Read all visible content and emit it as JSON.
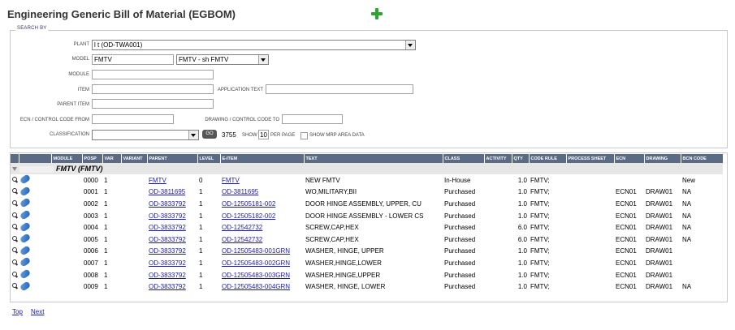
{
  "page": {
    "title": "Engineering Generic Bill of Material (EGBOM)"
  },
  "search": {
    "legend": "SEARCH BY",
    "plant_label": "PLANT",
    "plant_value": "l                                    t (OD-TWA001)",
    "model_label": "MODEL",
    "model_value": "FMTV",
    "model_select": "FMTV -           sh FMTV",
    "module_label": "MODULE",
    "item_label": "ITEM",
    "application_text_label": "APPLICATION TEXT",
    "parent_item_label": "PARENT ITEM",
    "ecn_from_label": "ECN / CONTROL CODE FROM",
    "drawing_to_label": "DRAWING / CONTROL CODE TO",
    "classification_label": "CLASSIFICATION",
    "go_label": "GO",
    "count": "3755",
    "show_label": "SHOW",
    "per_page_value": "10",
    "per_page_label": "PER PAGE",
    "mrp_label": "SHOW MRP AREA DATA"
  },
  "table": {
    "headers": [
      "",
      "",
      "MODULE",
      "POSP",
      "VAR",
      "VARIANT",
      "PARENT",
      "LEVEL",
      "E-ITEM",
      "TEXT",
      "CLASS",
      "ACTIVITY",
      "QTY",
      "CODE RULE",
      "PROCESS SHEET",
      "ECN",
      "DRAWING",
      "BCN CODE"
    ],
    "group_label": "FMTV (FMTV)",
    "rows": [
      {
        "posp": "0000",
        "var": "1",
        "parent": "FMTV",
        "level": "0",
        "eitem": "FMTV",
        "text": "NEW FMTV",
        "class": "In-House",
        "qty": "1.0",
        "code_rule": "FMTV;",
        "ecn": "",
        "drawing": "",
        "bcn": "New"
      },
      {
        "posp": "0001",
        "var": "1",
        "parent": "OD-3811695",
        "level": "1",
        "eitem": "OD-3811695",
        "text": "WO,MILITARY,BII",
        "class": "Purchased",
        "qty": "1.0",
        "code_rule": "FMTV;",
        "ecn": "ECN01",
        "drawing": "DRAW01",
        "bcn": "NA"
      },
      {
        "posp": "0002",
        "var": "1",
        "parent": "OD-3833792",
        "level": "1",
        "eitem": "OD-12505181-002",
        "text": "DOOR HINGE ASSEMBLY, UPPER, CU",
        "class": "Purchased",
        "qty": "1.0",
        "code_rule": "FMTV;",
        "ecn": "ECN01",
        "drawing": "DRAW01",
        "bcn": "NA"
      },
      {
        "posp": "0003",
        "var": "1",
        "parent": "OD-3833792",
        "level": "1",
        "eitem": "OD-12505182-002",
        "text": "DOOR HINGE ASSEMBLY - LOWER CS",
        "class": "Purchased",
        "qty": "1.0",
        "code_rule": "FMTV;",
        "ecn": "ECN01",
        "drawing": "DRAW01",
        "bcn": "NA"
      },
      {
        "posp": "0004",
        "var": "1",
        "parent": "OD-3833792",
        "level": "1",
        "eitem": "OD-12542732",
        "text": "SCREW,CAP,HEX",
        "class": "Purchased",
        "qty": "6.0",
        "code_rule": "FMTV;",
        "ecn": "ECN01",
        "drawing": "DRAW01",
        "bcn": "NA"
      },
      {
        "posp": "0005",
        "var": "1",
        "parent": "OD-3833792",
        "level": "1",
        "eitem": "OD-12542732",
        "text": "SCREW,CAP,HEX",
        "class": "Purchased",
        "qty": "6.0",
        "code_rule": "FMTV;",
        "ecn": "ECN01",
        "drawing": "DRAW01",
        "bcn": "NA"
      },
      {
        "posp": "0006",
        "var": "1",
        "parent": "OD-3833792",
        "level": "1",
        "eitem": "OD-12505483-001GRN",
        "text": "WASHER, HINGE, UPPER",
        "class": "Purchased",
        "qty": "1.0",
        "code_rule": "FMTV;",
        "ecn": "ECN01",
        "drawing": "DRAW01",
        "bcn": ""
      },
      {
        "posp": "0007",
        "var": "1",
        "parent": "OD-3833792",
        "level": "1",
        "eitem": "OD-12505483-002GRN",
        "text": "WASHER,HINGE,LOWER",
        "class": "Purchased",
        "qty": "1.0",
        "code_rule": "FMTV;",
        "ecn": "ECN01",
        "drawing": "DRAW01",
        "bcn": ""
      },
      {
        "posp": "0008",
        "var": "1",
        "parent": "OD-3833792",
        "level": "1",
        "eitem": "OD-12505483-003GRN",
        "text": "WASHER,HINGE,UPPER",
        "class": "Purchased",
        "qty": "1.0",
        "code_rule": "FMTV;",
        "ecn": "ECN01",
        "drawing": "DRAW01",
        "bcn": ""
      },
      {
        "posp": "0009",
        "var": "1",
        "parent": "OD-3833792",
        "level": "1",
        "eitem": "OD-12505483-004GRN",
        "text": "WASHER, HINGE, LOWER",
        "class": "Purchased",
        "qty": "1.0",
        "code_rule": "FMTV;",
        "ecn": "ECN01",
        "drawing": "DRAW01",
        "bcn": "NA"
      }
    ]
  },
  "footer": {
    "top": "Top",
    "next": "Next"
  }
}
